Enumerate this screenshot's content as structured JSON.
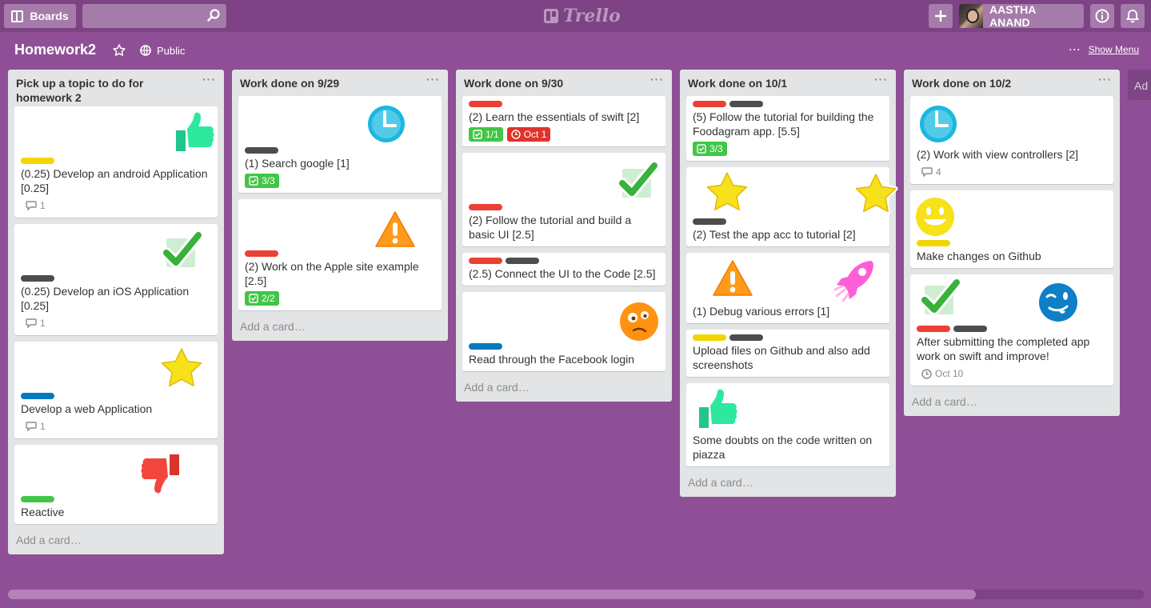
{
  "header": {
    "boards_label": "Boards",
    "search_placeholder": "",
    "logo_text": "Trello",
    "member_name": "AASTHA ANAND"
  },
  "board": {
    "title": "Homework2",
    "visibility": "Public",
    "show_menu": "Show Menu",
    "add_list_peek": "Ad"
  },
  "colors": {
    "background": "#8f4f96",
    "red": "#eb4036",
    "black": "#4d4d4d",
    "yellow": "#f2d600",
    "blue": "#0079bf",
    "green": "#42c548"
  },
  "lists": [
    {
      "title": "Pick up a topic to do for homework 2",
      "add_card": "Add a card…",
      "cards": [
        {
          "stickers": [
            "thumbs-up-icon"
          ],
          "labels": [
            "yellow"
          ],
          "title": "(0.25) Develop an android Application [0.25]",
          "comments": "1"
        },
        {
          "stickers": [
            "check-icon"
          ],
          "labels": [
            "black"
          ],
          "title": "(0.25) Develop an iOS Application [0.25]",
          "comments": "1"
        },
        {
          "stickers": [
            "star-icon"
          ],
          "labels": [
            "blue"
          ],
          "title": "Develop a web Application",
          "comments": "1"
        },
        {
          "stickers": [
            "thumbs-down-icon"
          ],
          "labels": [
            "green"
          ],
          "title": "Reactive"
        }
      ]
    },
    {
      "title": "Work done on 9/29",
      "add_card": "Add a card…",
      "cards": [
        {
          "stickers": [
            "clock-icon"
          ],
          "labels": [
            "black"
          ],
          "title": "(1) Search google [1]",
          "checklist": "3/3"
        },
        {
          "stickers": [
            "warning-icon"
          ],
          "labels": [
            "red"
          ],
          "title": "(2) Work on the Apple site example [2.5]",
          "checklist": "2/2"
        }
      ]
    },
    {
      "title": "Work done on 9/30",
      "add_card": "Add a card…",
      "cards": [
        {
          "labels": [
            "red"
          ],
          "title": "(2) Learn the essentials of swift [2]",
          "checklist": "1/1",
          "due": "Oct 1"
        },
        {
          "stickers": [
            "check-icon"
          ],
          "labels": [
            "red"
          ],
          "title": "(2) Follow the tutorial and build a basic UI [2.5]"
        },
        {
          "labels": [
            "red",
            "black"
          ],
          "title": "(2.5) Connect the UI to the Code [2.5]"
        },
        {
          "stickers": [
            "confused-face-icon"
          ],
          "labels": [
            "blue"
          ],
          "title": "Read through the Facebook login"
        }
      ]
    },
    {
      "title": "Work done on 10/1",
      "add_card": "Add a card…",
      "cards": [
        {
          "labels": [
            "red",
            "black"
          ],
          "title": "(5) Follow the tutorial for building the Foodagram app. [5.5]",
          "checklist": "3/3"
        },
        {
          "stickers": [
            "star-icon",
            "star-icon"
          ],
          "labels": [
            "black"
          ],
          "title": "(2) Test the app acc to tutorial [2]"
        },
        {
          "stickers": [
            "warning-icon",
            "rocket-icon"
          ],
          "labels": [],
          "title": "(1) Debug various errors [1]"
        },
        {
          "labels": [
            "yellow",
            "black"
          ],
          "title": "Upload files on Github and also add screenshots"
        },
        {
          "stickers": [
            "thumbs-up-icon"
          ],
          "labels": [],
          "title": "Some doubts on the code written on piazza"
        }
      ]
    },
    {
      "title": "Work done on 10/2",
      "add_card": "Add a card…",
      "cards": [
        {
          "stickers": [
            "clock-icon"
          ],
          "labels": [],
          "title": "(2) Work with view controllers [2]",
          "comments": "4"
        },
        {
          "stickers": [
            "smile-face-icon"
          ],
          "labels": [
            "yellow"
          ],
          "title": "Make changes on Github"
        },
        {
          "stickers": [
            "check-icon",
            "wink-face-icon"
          ],
          "labels": [
            "red",
            "black"
          ],
          "title": "After submitting the completed app work on swift and improve!",
          "due_plain": "Oct 10"
        }
      ]
    }
  ]
}
